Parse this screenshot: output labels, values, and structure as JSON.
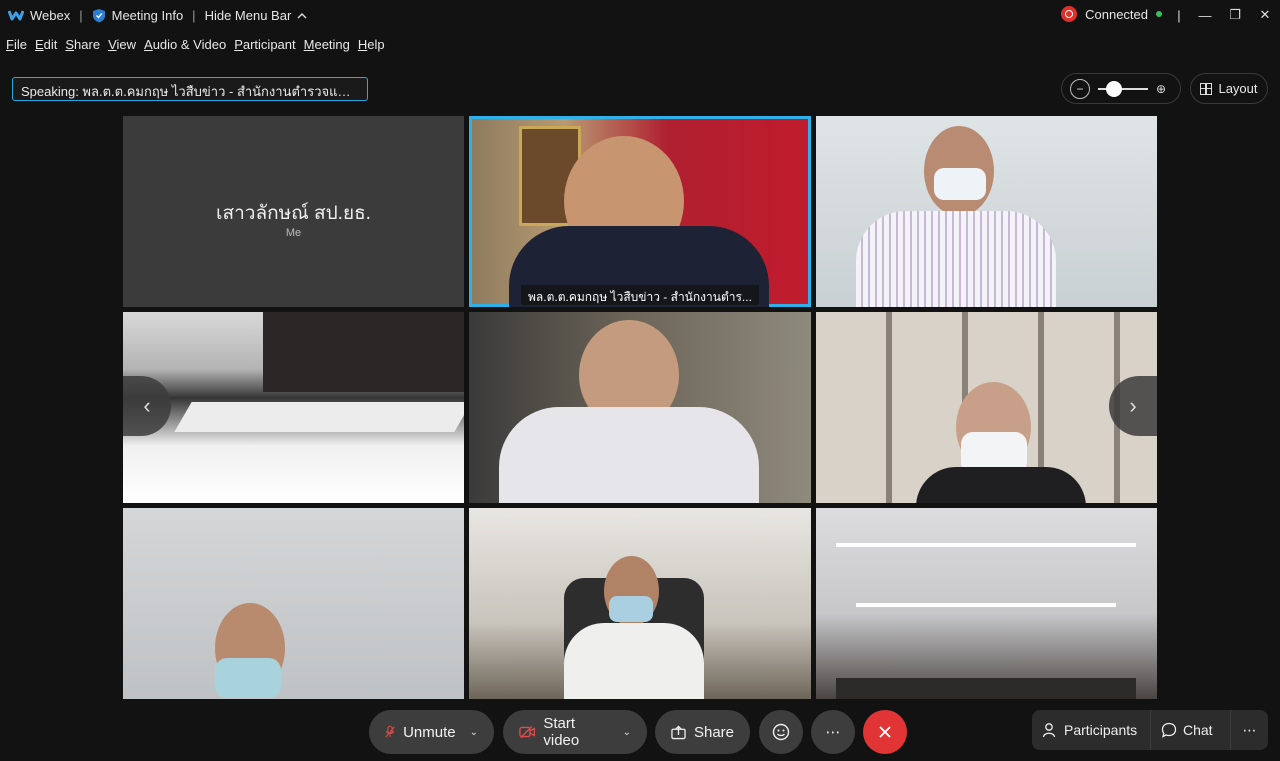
{
  "titlebar": {
    "app": "Webex",
    "meeting_info": "Meeting Info",
    "hide_menu_bar": "Hide Menu Bar",
    "status": "Connected"
  },
  "menu": [
    "File",
    "Edit",
    "Share",
    "View",
    "Audio & Video",
    "Participant",
    "Meeting",
    "Help"
  ],
  "speaking": "Speaking: พล.ต.ต.คมกฤษ ไวสืบข่าว - สำนักงานตำรวจแห่งชา...",
  "layout_label": "Layout",
  "tiles": {
    "me_name": "เสาวลักษณ์ สป.ยธ.",
    "me_sub": "Me",
    "active_label": "พล.ต.ต.คมกฤษ ไวสืบข่าว - สำนักงานตำร..."
  },
  "controls": {
    "unmute": "Unmute",
    "start_video": "Start video",
    "share": "Share",
    "participants": "Participants",
    "chat": "Chat"
  },
  "colors": {
    "accent": "#2eb0e8",
    "end_call": "#e13535",
    "record": "#e0302a",
    "connected": "#3cbf5a"
  }
}
